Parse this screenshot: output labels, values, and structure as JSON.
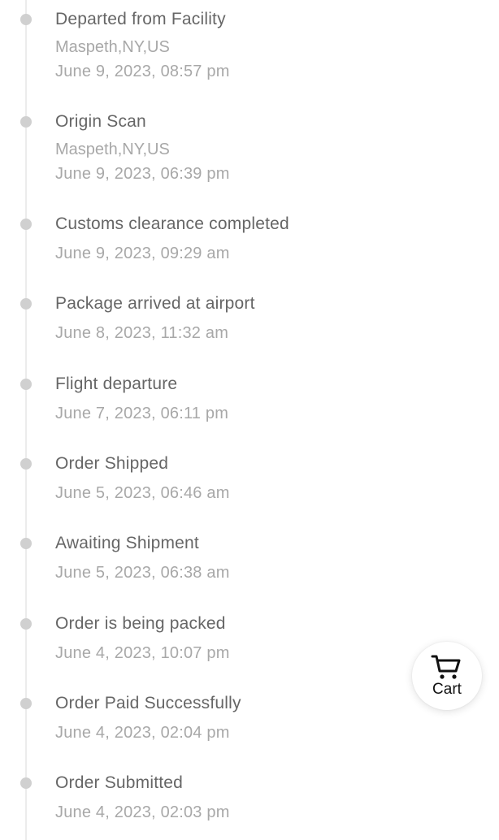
{
  "events": [
    {
      "title": "Departed from Facility",
      "location": "Maspeth,NY,US",
      "time": "June 9, 2023, 08:57 pm"
    },
    {
      "title": "Origin Scan",
      "location": "Maspeth,NY,US",
      "time": "June 9, 2023, 06:39 pm"
    },
    {
      "title": "Customs clearance completed",
      "time": "June 9, 2023, 09:29 am"
    },
    {
      "title": "Package arrived at airport",
      "time": "June 8, 2023, 11:32 am"
    },
    {
      "title": "Flight departure",
      "time": "June 7, 2023, 06:11 pm"
    },
    {
      "title": "Order Shipped",
      "time": "June 5, 2023, 06:46 am"
    },
    {
      "title": "Awaiting Shipment",
      "time": "June 5, 2023, 06:38 am"
    },
    {
      "title": "Order is being packed",
      "time": "June 4, 2023, 10:07 pm"
    },
    {
      "title": "Order Paid Successfully",
      "time": "June 4, 2023, 02:04 pm"
    },
    {
      "title": "Order Submitted",
      "time": "June 4, 2023, 02:03 pm"
    }
  ],
  "cart": {
    "label": "Cart",
    "icon": "cart-icon"
  },
  "colors": {
    "title": "#666666",
    "secondary": "#a8a8a8",
    "dot": "#d0d0d0",
    "line": "#ececec"
  }
}
